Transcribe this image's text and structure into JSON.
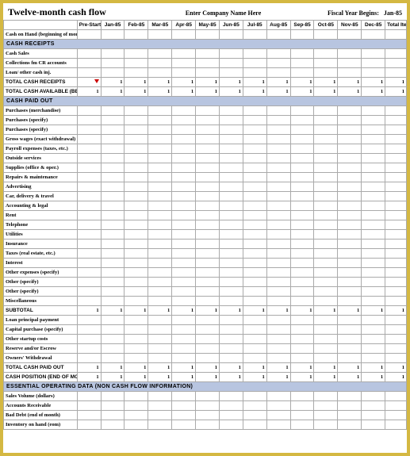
{
  "header": {
    "title": "Twelve-month cash flow",
    "company": "Enter Company Name Here",
    "fiscal_label": "Fiscal Year Begins:",
    "fiscal_value": "Jan-85"
  },
  "columns": {
    "label": "",
    "prestartup": "Pre-Startup EST",
    "months": [
      "Jan-85",
      "Feb-85",
      "Mar-85",
      "Apr-85",
      "May-85",
      "Jun-85",
      "Jul-85",
      "Aug-85",
      "Sep-85",
      "Oct-85",
      "Nov-85",
      "Dec-85"
    ],
    "total": "Total Item EST"
  },
  "rows": [
    {
      "type": "data",
      "label": "Cash on Hand (beginning of month)",
      "vals": [
        "",
        "",
        "",
        "",
        "",
        "",
        "",
        "",
        "",
        "",
        "",
        "",
        "",
        ""
      ]
    },
    {
      "type": "section",
      "label": "CASH RECEIPTS"
    },
    {
      "type": "data",
      "label": "Cash Sales",
      "vals": [
        "",
        "",
        "",
        "",
        "",
        "",
        "",
        "",
        "",
        "",
        "",
        "",
        "",
        ""
      ]
    },
    {
      "type": "data",
      "label": "Collections fm CR accounts",
      "vals": [
        "",
        "",
        "",
        "",
        "",
        "",
        "",
        "",
        "",
        "",
        "",
        "",
        "",
        ""
      ]
    },
    {
      "type": "data",
      "label": "Loan/ other cash inj.",
      "vals": [
        "",
        "",
        "",
        "",
        "",
        "",
        "",
        "",
        "",
        "",
        "",
        "",
        "",
        ""
      ]
    },
    {
      "type": "total",
      "label": "TOTAL CASH RECEIPTS",
      "marker": true,
      "vals": [
        "",
        "1",
        "1",
        "1",
        "1",
        "1",
        "1",
        "1",
        "1",
        "1",
        "1",
        "1",
        "1",
        "1"
      ]
    },
    {
      "type": "total",
      "label": "Total Cash Available (before cash out)",
      "vals": [
        "1",
        "1",
        "1",
        "1",
        "1",
        "1",
        "1",
        "1",
        "1",
        "1",
        "1",
        "1",
        "1",
        "1"
      ]
    },
    {
      "type": "section",
      "label": "CASH PAID OUT"
    },
    {
      "type": "data",
      "label": "Purchases (merchandise)",
      "vals": [
        "",
        "",
        "",
        "",
        "",
        "",
        "",
        "",
        "",
        "",
        "",
        "",
        "",
        ""
      ]
    },
    {
      "type": "data",
      "label": "Purchases (specify)",
      "vals": [
        "",
        "",
        "",
        "",
        "",
        "",
        "",
        "",
        "",
        "",
        "",
        "",
        "",
        ""
      ]
    },
    {
      "type": "data",
      "label": "Purchases (specify)",
      "vals": [
        "",
        "",
        "",
        "",
        "",
        "",
        "",
        "",
        "",
        "",
        "",
        "",
        "",
        ""
      ]
    },
    {
      "type": "data",
      "label": "Gross wages (exact withdrawal)",
      "vals": [
        "",
        "",
        "",
        "",
        "",
        "",
        "",
        "",
        "",
        "",
        "",
        "",
        "",
        ""
      ]
    },
    {
      "type": "data",
      "label": "Payroll expenses (taxes, etc.)",
      "vals": [
        "",
        "",
        "",
        "",
        "",
        "",
        "",
        "",
        "",
        "",
        "",
        "",
        "",
        ""
      ]
    },
    {
      "type": "data",
      "label": "Outside services",
      "vals": [
        "",
        "",
        "",
        "",
        "",
        "",
        "",
        "",
        "",
        "",
        "",
        "",
        "",
        ""
      ]
    },
    {
      "type": "data",
      "label": "Supplies (office & oper.)",
      "vals": [
        "",
        "",
        "",
        "",
        "",
        "",
        "",
        "",
        "",
        "",
        "",
        "",
        "",
        ""
      ]
    },
    {
      "type": "data",
      "label": "Repairs & maintenance",
      "vals": [
        "",
        "",
        "",
        "",
        "",
        "",
        "",
        "",
        "",
        "",
        "",
        "",
        "",
        ""
      ]
    },
    {
      "type": "data",
      "label": "Advertising",
      "vals": [
        "",
        "",
        "",
        "",
        "",
        "",
        "",
        "",
        "",
        "",
        "",
        "",
        "",
        ""
      ]
    },
    {
      "type": "data",
      "label": "Car, delivery & travel",
      "vals": [
        "",
        "",
        "",
        "",
        "",
        "",
        "",
        "",
        "",
        "",
        "",
        "",
        "",
        ""
      ]
    },
    {
      "type": "data",
      "label": "Accounting & legal",
      "vals": [
        "",
        "",
        "",
        "",
        "",
        "",
        "",
        "",
        "",
        "",
        "",
        "",
        "",
        ""
      ]
    },
    {
      "type": "data",
      "label": "Rent",
      "vals": [
        "",
        "",
        "",
        "",
        "",
        "",
        "",
        "",
        "",
        "",
        "",
        "",
        "",
        ""
      ]
    },
    {
      "type": "data",
      "label": "Telephone",
      "vals": [
        "",
        "",
        "",
        "",
        "",
        "",
        "",
        "",
        "",
        "",
        "",
        "",
        "",
        ""
      ]
    },
    {
      "type": "data",
      "label": "Utilities",
      "vals": [
        "",
        "",
        "",
        "",
        "",
        "",
        "",
        "",
        "",
        "",
        "",
        "",
        "",
        ""
      ]
    },
    {
      "type": "data",
      "label": "Insurance",
      "vals": [
        "",
        "",
        "",
        "",
        "",
        "",
        "",
        "",
        "",
        "",
        "",
        "",
        "",
        ""
      ]
    },
    {
      "type": "data",
      "label": "Taxes (real estate, etc.)",
      "vals": [
        "",
        "",
        "",
        "",
        "",
        "",
        "",
        "",
        "",
        "",
        "",
        "",
        "",
        ""
      ]
    },
    {
      "type": "data",
      "label": "Interest",
      "vals": [
        "",
        "",
        "",
        "",
        "",
        "",
        "",
        "",
        "",
        "",
        "",
        "",
        "",
        ""
      ]
    },
    {
      "type": "data",
      "label": "Other expenses (specify)",
      "vals": [
        "",
        "",
        "",
        "",
        "",
        "",
        "",
        "",
        "",
        "",
        "",
        "",
        "",
        ""
      ]
    },
    {
      "type": "data",
      "label": "Other (specify)",
      "vals": [
        "",
        "",
        "",
        "",
        "",
        "",
        "",
        "",
        "",
        "",
        "",
        "",
        "",
        ""
      ]
    },
    {
      "type": "data",
      "label": "Other (specify)",
      "vals": [
        "",
        "",
        "",
        "",
        "",
        "",
        "",
        "",
        "",
        "",
        "",
        "",
        "",
        ""
      ]
    },
    {
      "type": "data",
      "label": "Miscellaneous",
      "vals": [
        "",
        "",
        "",
        "",
        "",
        "",
        "",
        "",
        "",
        "",
        "",
        "",
        "",
        ""
      ]
    },
    {
      "type": "total",
      "label": "SUBTOTAL",
      "vals": [
        "1",
        "1",
        "1",
        "1",
        "1",
        "1",
        "1",
        "1",
        "1",
        "1",
        "1",
        "1",
        "1",
        "1"
      ]
    },
    {
      "type": "data",
      "label": "Loan principal payment",
      "vals": [
        "",
        "",
        "",
        "",
        "",
        "",
        "",
        "",
        "",
        "",
        "",
        "",
        "",
        ""
      ]
    },
    {
      "type": "data",
      "label": "Capital purchase (specify)",
      "vals": [
        "",
        "",
        "",
        "",
        "",
        "",
        "",
        "",
        "",
        "",
        "",
        "",
        "",
        ""
      ]
    },
    {
      "type": "data",
      "label": "Other startup costs",
      "vals": [
        "",
        "",
        "",
        "",
        "",
        "",
        "",
        "",
        "",
        "",
        "",
        "",
        "",
        ""
      ]
    },
    {
      "type": "data",
      "label": "Reserve and/or Escrow",
      "vals": [
        "",
        "",
        "",
        "",
        "",
        "",
        "",
        "",
        "",
        "",
        "",
        "",
        "",
        ""
      ]
    },
    {
      "type": "data",
      "label": "Owners' Withdrawal",
      "vals": [
        "",
        "",
        "",
        "",
        "",
        "",
        "",
        "",
        "",
        "",
        "",
        "",
        "",
        ""
      ]
    },
    {
      "type": "total",
      "label": "TOTAL CASH PAID OUT",
      "vals": [
        "1",
        "1",
        "1",
        "1",
        "1",
        "1",
        "1",
        "1",
        "1",
        "1",
        "1",
        "1",
        "1",
        "1"
      ]
    },
    {
      "type": "total",
      "label": "Cash Position (end of month)",
      "vals": [
        "1",
        "1",
        "1",
        "1",
        "1",
        "1",
        "1",
        "1",
        "1",
        "1",
        "1",
        "1",
        "1",
        "1"
      ]
    },
    {
      "type": "section",
      "label": "ESSENTIAL OPERATING DATA (non cash flow information)"
    },
    {
      "type": "data",
      "label": "Sales Volume (dollars)",
      "vals": [
        "",
        "",
        "",
        "",
        "",
        "",
        "",
        "",
        "",
        "",
        "",
        "",
        "",
        ""
      ]
    },
    {
      "type": "data",
      "label": "Accounts Receivable",
      "vals": [
        "",
        "",
        "",
        "",
        "",
        "",
        "",
        "",
        "",
        "",
        "",
        "",
        "",
        ""
      ]
    },
    {
      "type": "data",
      "label": "Bad Debt (end of month)",
      "vals": [
        "",
        "",
        "",
        "",
        "",
        "",
        "",
        "",
        "",
        "",
        "",
        "",
        "",
        ""
      ]
    },
    {
      "type": "data",
      "label": "Inventory on hand (eom)",
      "vals": [
        "",
        "",
        "",
        "",
        "",
        "",
        "",
        "",
        "",
        "",
        "",
        "",
        "",
        ""
      ]
    }
  ]
}
